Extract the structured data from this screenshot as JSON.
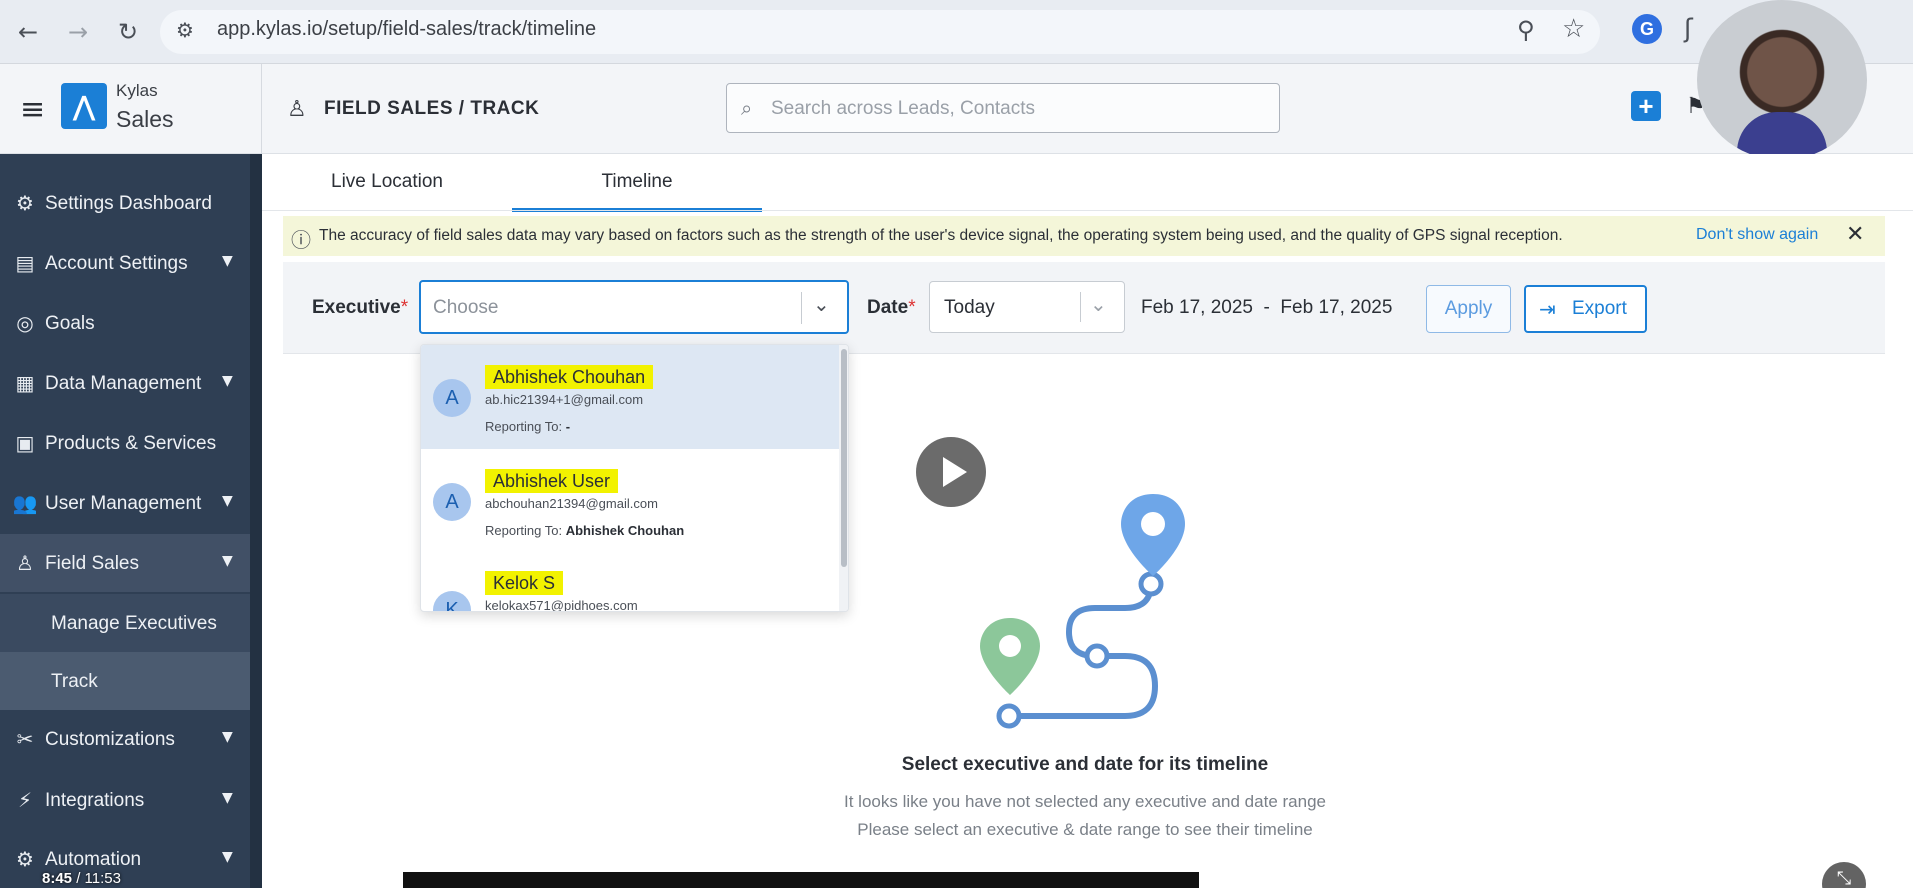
{
  "browser": {
    "url": "app.kylas.io/setup/field-sales/track/timeline",
    "icons": [
      "back-arrow-icon",
      "forward-arrow-icon",
      "reload-icon",
      "site-info-icon",
      "zoom-icon",
      "bookmark-star-icon",
      "extension-icon"
    ]
  },
  "app": {
    "logo_line1": "Kylas",
    "logo_line2": "Sales",
    "header_title": "FIELD SALES / TRACK",
    "search_placeholder": "Search across Leads, Contacts",
    "accent_color": "#1b7fd6"
  },
  "sidebar": {
    "items": [
      {
        "label": "Settings Dashboard",
        "icon": "gear-icon"
      },
      {
        "label": "Account Settings",
        "icon": "account-settings-icon",
        "expandable": true
      },
      {
        "label": "Goals",
        "icon": "goals-icon"
      },
      {
        "label": "Data Management",
        "icon": "table-icon",
        "expandable": true
      },
      {
        "label": "Products & Services",
        "icon": "box-icon"
      },
      {
        "label": "User Management",
        "icon": "users-icon",
        "expandable": true
      },
      {
        "label": "Field Sales",
        "icon": "person-pin-icon",
        "expandable": true
      },
      {
        "label": "Customizations",
        "icon": "tools-icon",
        "expandable": true
      },
      {
        "label": "Integrations",
        "icon": "plug-icon",
        "expandable": true
      },
      {
        "label": "Automation",
        "icon": "automation-icon",
        "expandable": true
      }
    ],
    "sub_items": [
      {
        "label": "Manage Executives"
      },
      {
        "label": "Track"
      }
    ]
  },
  "tabs": [
    {
      "label": "Live Location"
    },
    {
      "label": "Timeline"
    }
  ],
  "banner": {
    "message": "The accuracy of field sales data may vary based on factors such as the strength of the user's device signal, the operating system being used, and the quality of GPS signal reception.",
    "dismiss_label": "Don't show again",
    "close_label": "✕"
  },
  "filters": {
    "executive_label": "Executive",
    "executive_placeholder": "Choose",
    "date_label": "Date",
    "date_value": "Today",
    "required_mark": "*",
    "date_range": "Feb 17, 2025  -  Feb 17, 2025",
    "apply_label": "Apply",
    "export_label": "Export"
  },
  "dropdown": {
    "options": [
      {
        "initial": "A",
        "name": "Abhishek Chouhan",
        "email": "ab.hic21394+1@gmail.com",
        "reporting_prefix": "Reporting To:",
        "reporting_to": "-"
      },
      {
        "initial": "A",
        "name": "Abhishek User",
        "email": "abchouhan21394@gmail.com",
        "reporting_prefix": "Reporting To:",
        "reporting_to": "Abhishek Chouhan"
      },
      {
        "initial": "K",
        "name": "Kelok S",
        "email": "kelokax571@pidhoes.com"
      }
    ]
  },
  "empty_state": {
    "title": "Select executive and date for its timeline",
    "line1": "It looks like you have not selected any executive and date range",
    "line2": "Please select an executive & date range to see their timeline"
  },
  "video": {
    "current_time": "8:45",
    "separator": " / ",
    "total_time": "11:53"
  }
}
